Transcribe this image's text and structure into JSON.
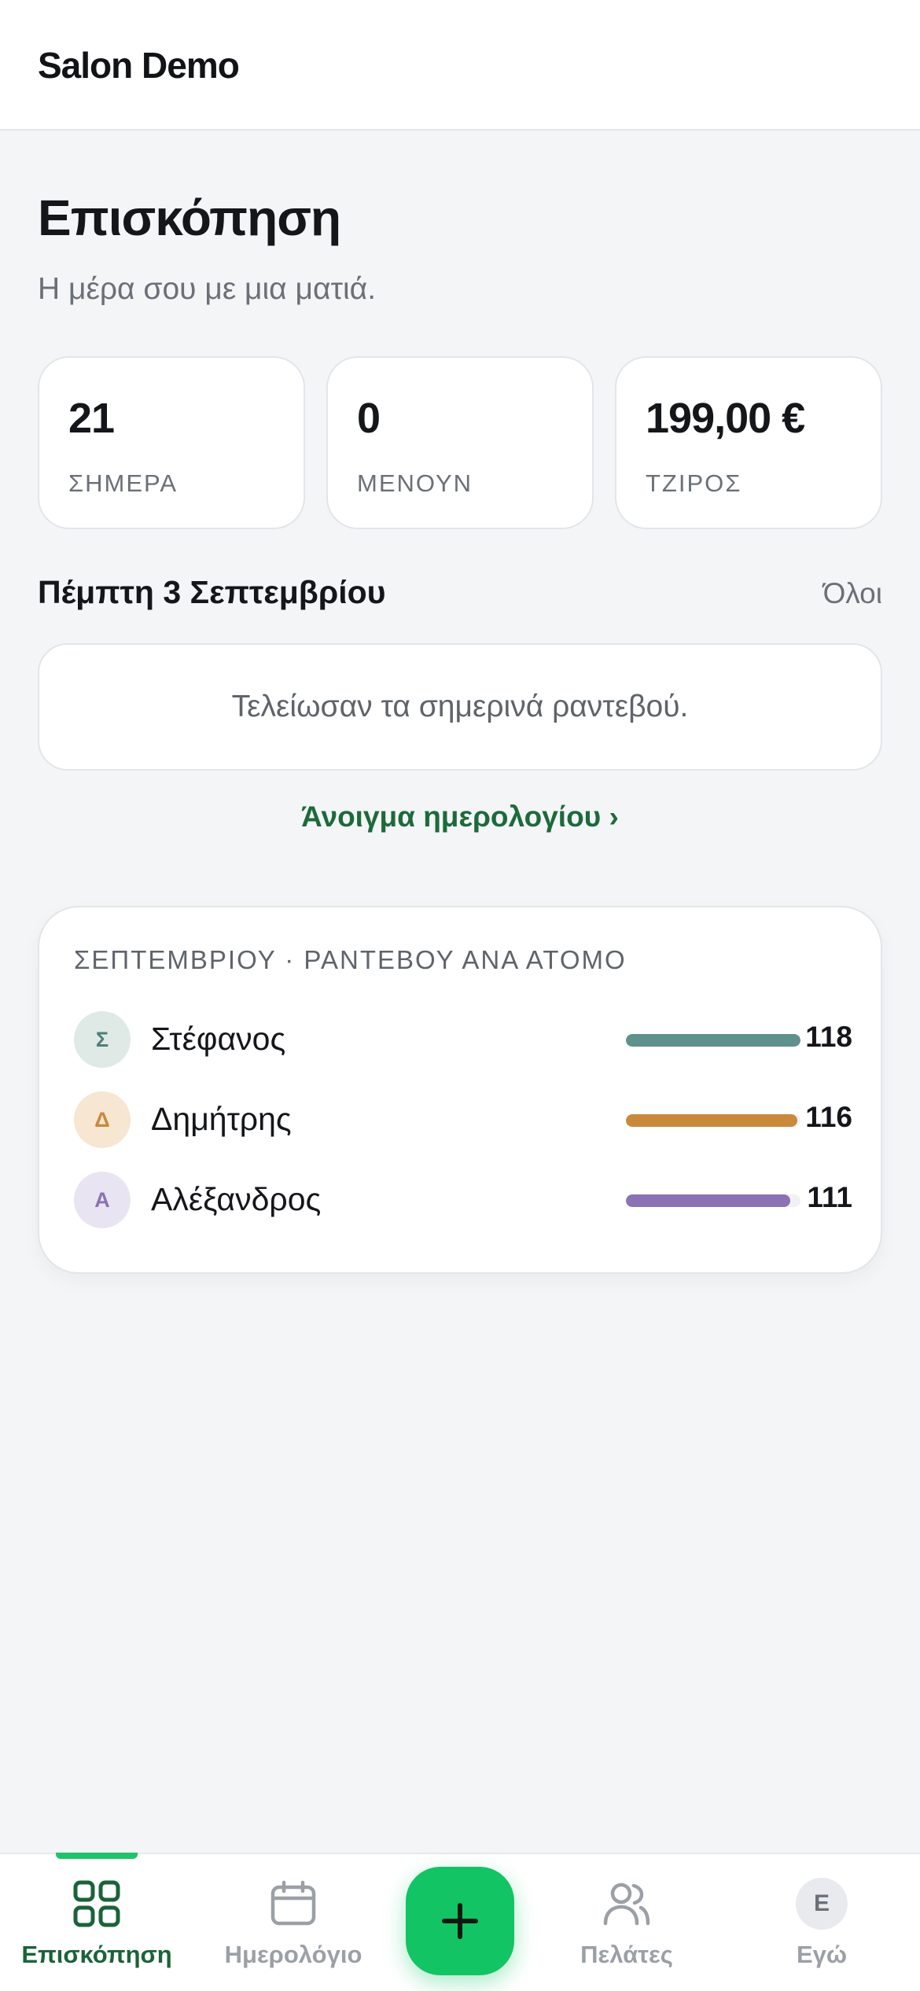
{
  "app": {
    "title": "Salon Demo"
  },
  "header": {
    "title": "Επισκόπηση",
    "subtitle": "Η μέρα σου με μια ματιά."
  },
  "stats": [
    {
      "value": "21",
      "label": "ΣΗΜΕΡΑ"
    },
    {
      "value": "0",
      "label": "ΜΕΝΟΥΝ"
    },
    {
      "value": "199,00 €",
      "label": "ΤΖΙΡΟΣ"
    }
  ],
  "day": {
    "title": "Πέμπτη 3 Σεπτεμβρίου",
    "all_link": "Όλοι",
    "empty_text": "Τελείωσαν τα σημερινά ραντεβού.",
    "open_calendar": "Άνοιγμα ημερολογίου ›"
  },
  "people_stats": {
    "heading": "ΣΕΠΤΕΜΒΡΙΟΥ · ΡΑΝΤΕΒΟΥ ΑΝΑ ΑΤΟΜΟ",
    "people": [
      {
        "initial": "Σ",
        "name": "Στέφανος",
        "count": "118",
        "fraction": 1.0,
        "color": "#5e9189",
        "avatar_bg": "#dfe9e6",
        "avatar_fg": "#4f7f77"
      },
      {
        "initial": "Δ",
        "name": "Δημήτρης",
        "count": "116",
        "fraction": 0.983,
        "color": "#c9893b",
        "avatar_bg": "#f6e6d2",
        "avatar_fg": "#c9893b"
      },
      {
        "initial": "Α",
        "name": "Αλέξανδρος",
        "count": "111",
        "fraction": 0.94,
        "color": "#8a72b4",
        "avatar_bg": "#e8e4f1",
        "avatar_fg": "#8a72b4"
      }
    ]
  },
  "nav": {
    "items": [
      {
        "label": "Επισκόπηση",
        "icon": "grid-icon",
        "active": true
      },
      {
        "label": "Ημερολόγιο",
        "icon": "calendar-icon",
        "active": false
      },
      {
        "label": "Πελάτες",
        "icon": "users-icon",
        "active": false
      },
      {
        "label": "Εγώ",
        "icon": "avatar-icon",
        "active": false,
        "initial": "Ε"
      }
    ],
    "fab_icon": "plus-icon"
  },
  "colors": {
    "accent": "#12c463",
    "accent_dark": "#1a6339",
    "background": "#f4f5f7"
  }
}
